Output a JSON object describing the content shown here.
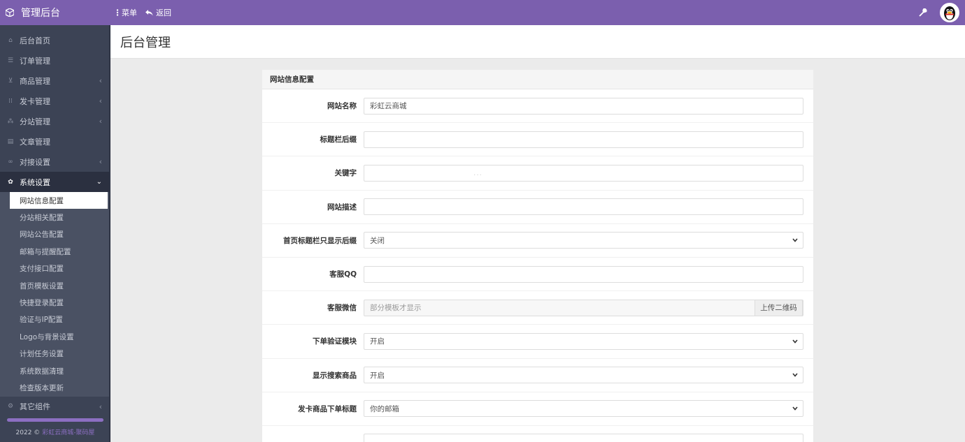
{
  "header": {
    "brand": "管理后台",
    "menu_label": "菜单",
    "back_label": "返回"
  },
  "sidebar": {
    "items": [
      {
        "label": "后台首页",
        "icon": "home-icon",
        "has_arrow": false
      },
      {
        "label": "订单管理",
        "icon": "list-icon",
        "has_arrow": false
      },
      {
        "label": "商品管理",
        "icon": "cart-icon",
        "has_arrow": true
      },
      {
        "label": "发卡管理",
        "icon": "grid-icon",
        "has_arrow": true
      },
      {
        "label": "分站管理",
        "icon": "sitemap-icon",
        "has_arrow": true
      },
      {
        "label": "文章管理",
        "icon": "book-icon",
        "has_arrow": false
      },
      {
        "label": "对接设置",
        "icon": "link-icon",
        "has_arrow": true
      }
    ],
    "active_section": {
      "label": "系统设置",
      "icon": "gear-icon"
    },
    "submenu": [
      "网站信息配置",
      "分站相关配置",
      "网站公告配置",
      "邮箱与提醒配置",
      "支付接口配置",
      "首页模板设置",
      "快捷登录配置",
      "验证与IP配置",
      "Logo与背景设置",
      "计划任务设置",
      "系统数据清理",
      "检查版本更新"
    ],
    "bottom_item": {
      "label": "其它组件",
      "icon": "cogs-icon"
    },
    "footer_year": "2022 ©",
    "footer_link": "彩虹云商城-聚码屋"
  },
  "page": {
    "title": "后台管理"
  },
  "panel": {
    "title": "网站信息配置",
    "rows": [
      {
        "label": "网站名称",
        "type": "text",
        "value": "彩虹云商城"
      },
      {
        "label": "标题栏后缀",
        "type": "text",
        "value": ""
      },
      {
        "label": "关键字",
        "type": "text",
        "value": "..."
      },
      {
        "label": "网站描述",
        "type": "text",
        "value": ""
      },
      {
        "label": "首页标题栏只显示后缀",
        "type": "select",
        "value": "关闭"
      },
      {
        "label": "客服QQ",
        "type": "text",
        "value": ""
      },
      {
        "label": "客服微信",
        "type": "addon",
        "placeholder": "部分模板才显示",
        "addon": "上传二维码"
      },
      {
        "label": "下单验证模块",
        "type": "select",
        "value": "开启"
      },
      {
        "label": "显示搜索商品",
        "type": "select",
        "value": "开启"
      },
      {
        "label": "发卡商品下单标题",
        "type": "select",
        "value": "你的邮箱"
      }
    ]
  },
  "colors": {
    "topbar": "#7b5fae",
    "sidebar": "#3c4355",
    "accent": "#8c6fc2"
  }
}
